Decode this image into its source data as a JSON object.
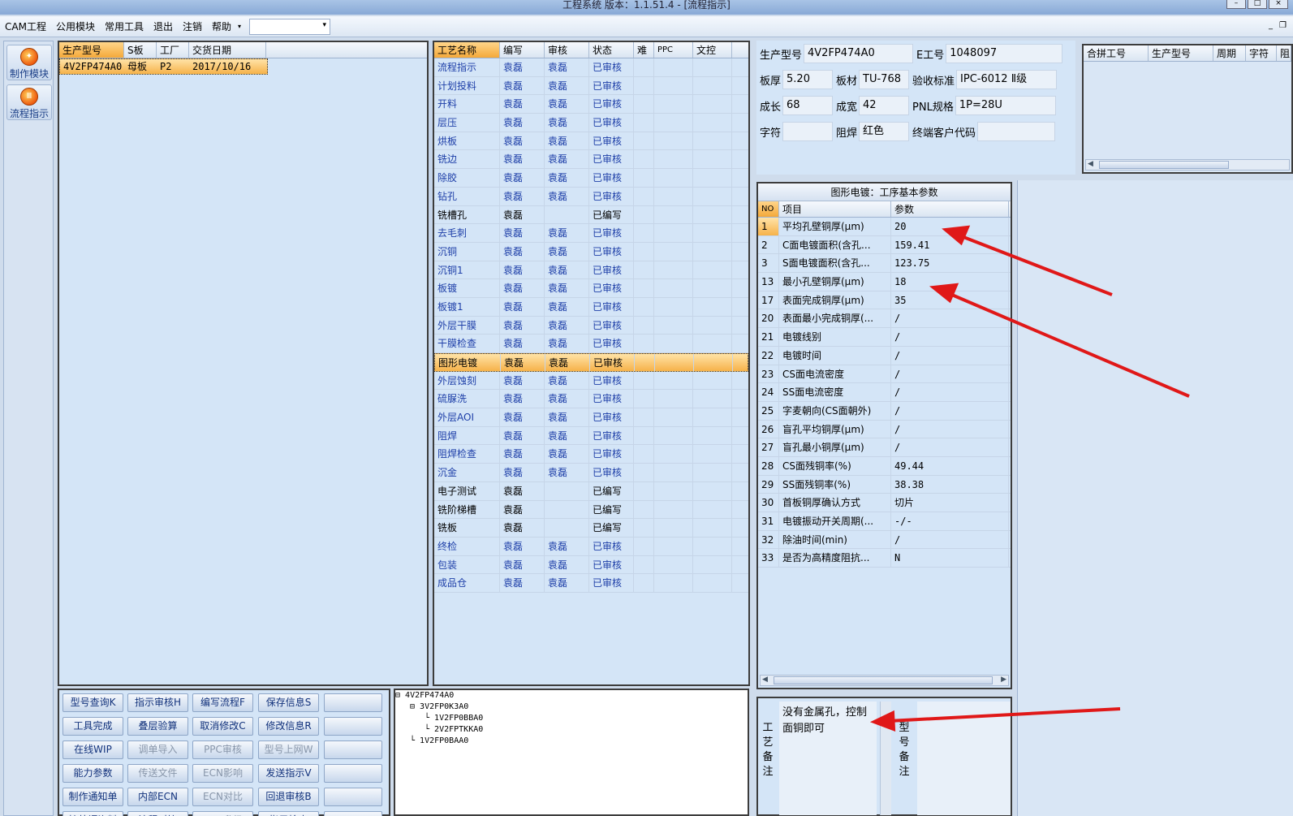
{
  "window": {
    "title": "工程系统   版本：1.1.51.4 - [流程指示]"
  },
  "menu": {
    "items": [
      "CAM工程",
      "公用模块",
      "常用工具",
      "退出",
      "注销",
      "帮助"
    ],
    "combo_value": ""
  },
  "left_nav": [
    {
      "label": "制作模块",
      "icon": "make-module-icon"
    },
    {
      "label": "流程指示",
      "icon": "flow-guide-icon"
    }
  ],
  "model_grid": {
    "headers": [
      "生产型号",
      "S板",
      "工厂",
      "交货日期"
    ],
    "rows": [
      {
        "model": "4V2FP474A0",
        "s_board": "母板",
        "factory": "P2",
        "date": "2017/10/16"
      }
    ]
  },
  "process_grid": {
    "headers": [
      "工艺名称",
      "编写",
      "审核",
      "状态",
      "难",
      "PPC",
      "文控"
    ],
    "selected_index": 16,
    "rows": [
      {
        "name": "流程指示",
        "writer": "袁磊",
        "reviewer": "袁磊",
        "status": "已审核"
      },
      {
        "name": "计划投料",
        "writer": "袁磊",
        "reviewer": "袁磊",
        "status": "已审核"
      },
      {
        "name": "开料",
        "writer": "袁磊",
        "reviewer": "袁磊",
        "status": "已审核"
      },
      {
        "name": "层压",
        "writer": "袁磊",
        "reviewer": "袁磊",
        "status": "已审核"
      },
      {
        "name": "烘板",
        "writer": "袁磊",
        "reviewer": "袁磊",
        "status": "已审核"
      },
      {
        "name": "铣边",
        "writer": "袁磊",
        "reviewer": "袁磊",
        "status": "已审核"
      },
      {
        "name": "除胶",
        "writer": "袁磊",
        "reviewer": "袁磊",
        "status": "已审核"
      },
      {
        "name": "钻孔",
        "writer": "袁磊",
        "reviewer": "袁磊",
        "status": "已审核"
      },
      {
        "name": "铣槽孔",
        "writer": "袁磊",
        "reviewer": "",
        "status": "已编写"
      },
      {
        "name": "去毛刺",
        "writer": "袁磊",
        "reviewer": "袁磊",
        "status": "已审核"
      },
      {
        "name": "沉铜",
        "writer": "袁磊",
        "reviewer": "袁磊",
        "status": "已审核"
      },
      {
        "name": "沉铜1",
        "writer": "袁磊",
        "reviewer": "袁磊",
        "status": "已审核"
      },
      {
        "name": "板镀",
        "writer": "袁磊",
        "reviewer": "袁磊",
        "status": "已审核"
      },
      {
        "name": "板镀1",
        "writer": "袁磊",
        "reviewer": "袁磊",
        "status": "已审核"
      },
      {
        "name": "外层干膜",
        "writer": "袁磊",
        "reviewer": "袁磊",
        "status": "已审核"
      },
      {
        "name": "干膜检查",
        "writer": "袁磊",
        "reviewer": "袁磊",
        "status": "已审核"
      },
      {
        "name": "图形电镀",
        "writer": "袁磊",
        "reviewer": "袁磊",
        "status": "已审核"
      },
      {
        "name": "外层蚀刻",
        "writer": "袁磊",
        "reviewer": "袁磊",
        "status": "已审核"
      },
      {
        "name": "硫脲洗",
        "writer": "袁磊",
        "reviewer": "袁磊",
        "status": "已审核"
      },
      {
        "name": "外层AOI",
        "writer": "袁磊",
        "reviewer": "袁磊",
        "status": "已审核"
      },
      {
        "name": "阻焊",
        "writer": "袁磊",
        "reviewer": "袁磊",
        "status": "已审核"
      },
      {
        "name": "阻焊检查",
        "writer": "袁磊",
        "reviewer": "袁磊",
        "status": "已审核"
      },
      {
        "name": "沉金",
        "writer": "袁磊",
        "reviewer": "袁磊",
        "status": "已审核"
      },
      {
        "name": "电子测试",
        "writer": "袁磊",
        "reviewer": "",
        "status": "已编写"
      },
      {
        "name": "铣阶梯槽",
        "writer": "袁磊",
        "reviewer": "",
        "status": "已编写"
      },
      {
        "name": "铣板",
        "writer": "袁磊",
        "reviewer": "",
        "status": "已编写"
      },
      {
        "name": "终检",
        "writer": "袁磊",
        "reviewer": "袁磊",
        "status": "已审核"
      },
      {
        "name": "包装",
        "writer": "袁磊",
        "reviewer": "袁磊",
        "status": "已审核"
      },
      {
        "name": "成品仓",
        "writer": "袁磊",
        "reviewer": "袁磊",
        "status": "已审核"
      }
    ]
  },
  "info": {
    "model_label": "生产型号",
    "model_value": "4V2FP474A0",
    "e_label": "E工号",
    "e_value": "1048097",
    "thick_label": "板厚",
    "thick_value": "5.20",
    "material_label": "板材",
    "material_value": "TU-768",
    "std_label": "验收标准",
    "std_value": "IPC-6012 Ⅱ级",
    "len_label": "成长",
    "len_value": "68",
    "wid_label": "成宽",
    "wid_value": "42",
    "pnl_label": "PNL规格",
    "pnl_value": "1P=28U",
    "char_label": "字符",
    "char_value": "",
    "mask_label": "阻焊",
    "mask_value": "红色",
    "cust_label": "终端客户代码",
    "cust_value": ""
  },
  "merge_grid": {
    "headers": [
      "合拼工号",
      "生产型号",
      "周期",
      "字符",
      "阻"
    ]
  },
  "params": {
    "title": "图形电镀：工序基本参数",
    "headers": [
      "NO",
      "项目",
      "参数"
    ],
    "rows": [
      {
        "no": "1",
        "item": "平均孔壁铜厚(μm)",
        "value": "20"
      },
      {
        "no": "2",
        "item": "C面电镀面积(含孔...",
        "value": "159.41"
      },
      {
        "no": "3",
        "item": "S面电镀面积(含孔...",
        "value": "123.75"
      },
      {
        "no": "13",
        "item": "最小孔壁铜厚(μm)",
        "value": "18"
      },
      {
        "no": "17",
        "item": "表面完成铜厚(μm)",
        "value": "35"
      },
      {
        "no": "20",
        "item": "表面最小完成铜厚(...",
        "value": "/"
      },
      {
        "no": "21",
        "item": "电镀线别",
        "value": "/"
      },
      {
        "no": "22",
        "item": "电镀时间",
        "value": "/"
      },
      {
        "no": "23",
        "item": "CS面电流密度",
        "value": "/"
      },
      {
        "no": "24",
        "item": "SS面电流密度",
        "value": "/"
      },
      {
        "no": "25",
        "item": "字麦朝向(CS面朝外)",
        "value": "/"
      },
      {
        "no": "26",
        "item": "盲孔平均铜厚(μm)",
        "value": "/"
      },
      {
        "no": "27",
        "item": "盲孔最小铜厚(μm)",
        "value": "/"
      },
      {
        "no": "28",
        "item": "CS面残铜率(%)",
        "value": "49.44"
      },
      {
        "no": "29",
        "item": "SS面残铜率(%)",
        "value": "38.38"
      },
      {
        "no": "30",
        "item": "首板铜厚确认方式",
        "value": "切片"
      },
      {
        "no": "31",
        "item": "电镀振动开关周期(...",
        "value": "-/-"
      },
      {
        "no": "32",
        "item": "除油时间(min)",
        "value": "/"
      },
      {
        "no": "33",
        "item": "是否为高精度阻抗...",
        "value": "N"
      }
    ]
  },
  "notes": {
    "process_label": "工艺备注",
    "process_text": "没有金属孔，控制面铜即可",
    "model_label": "型号备注"
  },
  "buttons": [
    [
      "型号查询K",
      "指示审核H",
      "编写流程F",
      "保存信息S",
      ""
    ],
    [
      "工具完成",
      "叠层验算",
      "取消修改C",
      "修改信息R",
      ""
    ],
    [
      "在线WIP",
      "调单导入",
      "PPC审核",
      "型号上网W",
      ""
    ],
    [
      "能力参数",
      "传送文件",
      "ECN影响",
      "发送指示V",
      ""
    ],
    [
      "制作通知单",
      "内部ECN",
      "ECN对比",
      "回退审核B",
      ""
    ],
    [
      "接外调资料",
      "流程对比",
      "ECN升级",
      "指示检查",
      ""
    ]
  ],
  "tree": [
    {
      "label": "4V2FP474A0",
      "level": 0
    },
    {
      "label": "3V2FP0K3A0",
      "level": 1
    },
    {
      "label": "1V2FP0BBA0",
      "level": 2
    },
    {
      "label": "2V2FPTKKA0",
      "level": 2
    },
    {
      "label": "1V2FP0BAA0",
      "level": 1
    }
  ],
  "colors": {
    "accent": "#f6b24a",
    "link": "#1e3fa8",
    "arrow": "#e01818"
  }
}
